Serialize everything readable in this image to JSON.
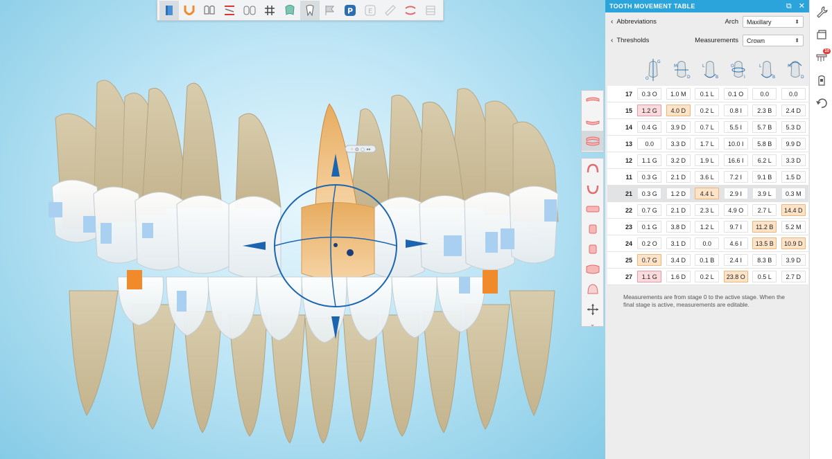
{
  "viewport": {
    "label": "3d-dental-model",
    "handle_label": "◦ ⊙ ◌ ↔"
  },
  "toolbar": {
    "tools": [
      {
        "name": "book-icon",
        "active": true
      },
      {
        "name": "u-arch-icon",
        "active": false
      },
      {
        "name": "teeth-pair-icon",
        "active": false
      },
      {
        "name": "bite-split-icon",
        "active": false
      },
      {
        "name": "numbering-icon",
        "label": "11 21",
        "active": false
      },
      {
        "name": "grid-icon",
        "active": false
      },
      {
        "name": "tooth-overlay-icon",
        "active": false
      },
      {
        "name": "single-tooth-icon",
        "active": true
      },
      {
        "name": "flag-icon",
        "active": false
      },
      {
        "name": "p-icon",
        "label": "P",
        "active": false
      },
      {
        "name": "e-icon",
        "label": "E",
        "active": false
      },
      {
        "name": "ruler-icon",
        "active": false
      },
      {
        "name": "jaw-icon",
        "active": false
      },
      {
        "name": "stack-icon",
        "active": false
      }
    ]
  },
  "panel": {
    "title": "TOOTH MOVEMENT TABLE",
    "abbreviations_label": "Abbreviations",
    "thresholds_label": "Thresholds",
    "arch_label": "Arch",
    "arch_value": "Maxillary",
    "measurements_label": "Measurements",
    "measurements_value": "Crown",
    "column_icons": [
      {
        "name": "extrusion-intrusion-icon",
        "labels": [
          "G",
          "O"
        ]
      },
      {
        "name": "mesial-distal-icon",
        "labels": [
          "M",
          "D"
        ]
      },
      {
        "name": "lingual-buccal-icon",
        "labels": [
          "L",
          "B"
        ]
      },
      {
        "name": "rotation-icon",
        "labels": [
          "O",
          "I"
        ]
      },
      {
        "name": "angulation-icon",
        "labels": [
          "L",
          "B"
        ]
      },
      {
        "name": "inclination-icon",
        "labels": [
          "M",
          "D"
        ]
      }
    ],
    "rows": [
      {
        "tooth": "17",
        "cells": [
          "0.3 O",
          "1.0 M",
          "0.1 L",
          "0.1 O",
          "0.0",
          "0.0"
        ],
        "flags": [
          "",
          "",
          "",
          "",
          "",
          ""
        ],
        "highlight": false
      },
      {
        "tooth": "15",
        "cells": [
          "1.2 G",
          "4.0 D",
          "0.2 L",
          "0.8 I",
          "2.3 B",
          "2.4 D"
        ],
        "flags": [
          "r",
          "o",
          "",
          "",
          "",
          ""
        ],
        "highlight": false
      },
      {
        "tooth": "14",
        "cells": [
          "0.4 G",
          "3.9 D",
          "0.7 L",
          "5.5 I",
          "5.7 B",
          "5.3 D"
        ],
        "flags": [
          "",
          "",
          "",
          "",
          "",
          ""
        ],
        "highlight": false
      },
      {
        "tooth": "13",
        "cells": [
          "0.0",
          "3.3 D",
          "1.7 L",
          "10.0 I",
          "5.8 B",
          "9.9 D"
        ],
        "flags": [
          "",
          "",
          "",
          "",
          "",
          ""
        ],
        "highlight": false
      },
      {
        "tooth": "12",
        "cells": [
          "1.1 G",
          "3.2 D",
          "1.9 L",
          "16.6 I",
          "6.2 L",
          "3.3 D"
        ],
        "flags": [
          "",
          "",
          "",
          "",
          "",
          ""
        ],
        "highlight": false
      },
      {
        "tooth": "11",
        "cells": [
          "0.3 G",
          "2.1 D",
          "3.6 L",
          "7.2 I",
          "9.1 B",
          "1.5 D"
        ],
        "flags": [
          "",
          "",
          "",
          "",
          "",
          ""
        ],
        "highlight": false
      },
      {
        "tooth": "21",
        "cells": [
          "0.3 G",
          "1.2 D",
          "4.4 L",
          "2.9 I",
          "3.9 L",
          "0.3 M"
        ],
        "flags": [
          "",
          "",
          "o",
          "",
          "",
          ""
        ],
        "highlight": true
      },
      {
        "tooth": "22",
        "cells": [
          "0.7 G",
          "2.1 D",
          "2.3 L",
          "4.9 O",
          "2.7 L",
          "14.4 D"
        ],
        "flags": [
          "",
          "",
          "",
          "",
          "",
          "o"
        ],
        "highlight": false
      },
      {
        "tooth": "23",
        "cells": [
          "0.1 G",
          "3.8 D",
          "1.2 L",
          "9.7 I",
          "11.2 B",
          "5.2 M"
        ],
        "flags": [
          "",
          "",
          "",
          "",
          "o",
          ""
        ],
        "highlight": false
      },
      {
        "tooth": "24",
        "cells": [
          "0.2 O",
          "3.1 D",
          "0.0",
          "4.6 I",
          "13.5 B",
          "10.9 D"
        ],
        "flags": [
          "",
          "",
          "",
          "",
          "o",
          "o"
        ],
        "highlight": false
      },
      {
        "tooth": "25",
        "cells": [
          "0.7 G",
          "3.4 D",
          "0.1 B",
          "2.4 I",
          "8.3 B",
          "3.9 D"
        ],
        "flags": [
          "o",
          "",
          "",
          "",
          "",
          ""
        ],
        "highlight": false
      },
      {
        "tooth": "27",
        "cells": [
          "1.1 G",
          "1.6 D",
          "0.2 L",
          "23.8 O",
          "0.5 L",
          "2.7 D"
        ],
        "flags": [
          "r",
          "",
          "",
          "o",
          "",
          ""
        ],
        "highlight": false
      }
    ],
    "note": "Measurements are from stage 0 to the active stage. When the final stage is active, measurements are editable."
  },
  "sidebar": {
    "badge_count": "10",
    "items": [
      "wrench-icon",
      "layers-icon",
      "tooth-movement-icon",
      "attachment-icon",
      "undo-icon"
    ]
  },
  "colors": {
    "accent": "#2aa4db",
    "warn_red": "#fadadd",
    "warn_orange": "#fde4c8",
    "tooth": "#ece3cc",
    "active_tooth": "#f2c58d",
    "attachment_blue": "#a9d0f0",
    "attachment_orange": "#f08a2a"
  }
}
